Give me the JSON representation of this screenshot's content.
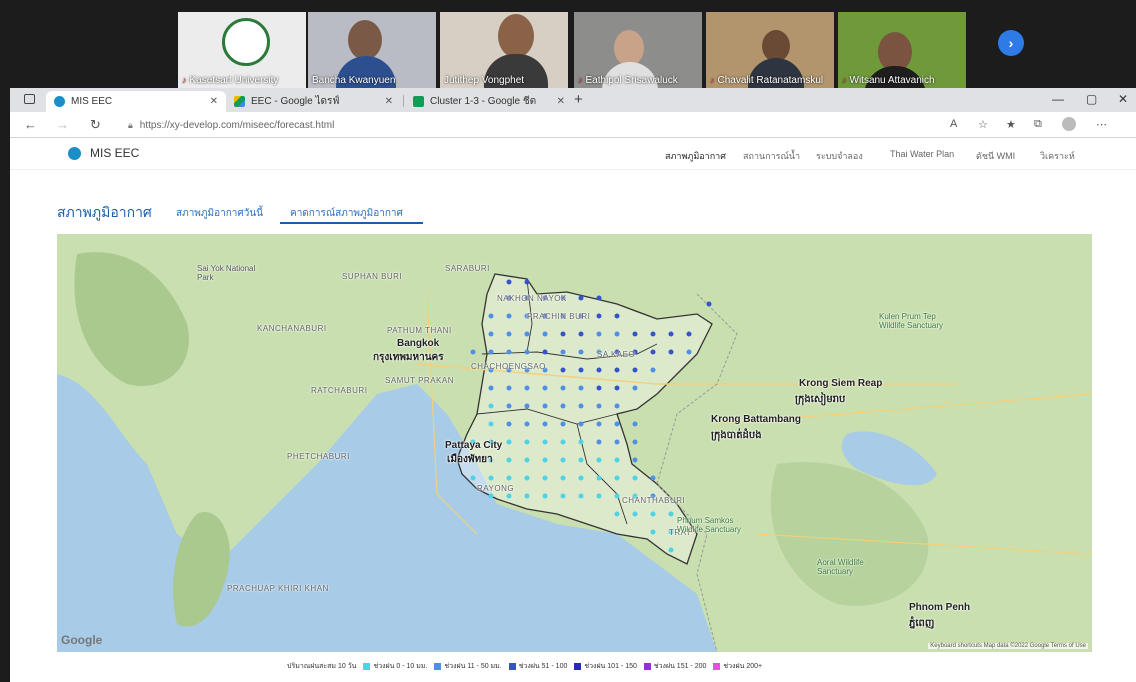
{
  "video_call": {
    "participants": [
      {
        "name": "Kasetsart University"
      },
      {
        "name": "Bancha Kwanyuen"
      },
      {
        "name": "Jutithep Vongphet"
      },
      {
        "name": "Eathipol Srisawaluck"
      },
      {
        "name": "Chavalit Ratanatamskul"
      },
      {
        "name": "Witsanu Attavanich"
      }
    ],
    "next_icon": "chevron-right-icon"
  },
  "browser": {
    "tabs": [
      {
        "label": "MIS EEC",
        "color": "#1a8fc7"
      },
      {
        "label": "EEC - Google ไดรฟ์",
        "color": "#f4b400"
      },
      {
        "label": "Cluster 1-3 - Google ชีต",
        "color": "#0f9d58"
      }
    ],
    "url": "https://xy-develop.com/miseec/forecast.html"
  },
  "app": {
    "title": "MIS EEC",
    "menu": [
      {
        "label": "สภาพภูมิอากาศ"
      },
      {
        "label": "สถานการณ์น้ำ"
      },
      {
        "label": "ระบบจำลอง"
      },
      {
        "label": "Thai Water Plan"
      },
      {
        "label": "ดัชนี WMI"
      },
      {
        "label": "วิเคราะห์"
      }
    ]
  },
  "page": {
    "title": "สภาพภูมิอากาศ",
    "subtabs": [
      {
        "label": "สภาพภูมิอากาศวันนี้"
      },
      {
        "label": "คาดการณ์สภาพภูมิอากาศ"
      }
    ]
  },
  "map": {
    "labels": {
      "suphan_buri": "SUPHAN BURI",
      "saraburi": "SARABURI",
      "kanchanaburi": "KANCHANABURI",
      "pathum_thani": "PATHUM THANI",
      "bangkok": "Bangkok",
      "bangkok_th": "กรุงเทพมหานคร",
      "samut_prakan": "SAMUT PRAKAN",
      "ratchaburi": "RATCHABURI",
      "phetchaburi": "PHETCHABURI",
      "chachoengsao": "CHACHOENGSAO",
      "prachin_buri": "PRACHIN BURI",
      "nakhon_nayok": "NAKHON NAYOK",
      "sa_kaeo": "SA KAEO",
      "pattaya": "Pattaya City",
      "pattaya_th": "เมืองพัทยา",
      "rayong": "RAYONG",
      "chanthaburi": "CHANTHABURI",
      "trat": "TRAT",
      "prachuap": "PRACHUAP KHIRI KHAN",
      "siem_reap": "Krong Siem Reap",
      "siem_reap_km": "ក្រុងសៀមរាប",
      "battambang": "Krong Battambang",
      "battambang_km": "ក្រុងបាត់ដំបង",
      "phnom_penh": "Phnom Penh",
      "phnom_penh_km": "ភ្នំពេញ",
      "sai_yok": "Sai Yok National Park",
      "phnum_samkos": "Phnum Samkos Wildlife Sanctuary",
      "aoral": "Aoral Wildlife Sanctuary",
      "kulen": "Kulen Prum Tep Wildlife Sanctuary"
    },
    "google": "Google",
    "footer": "Keyboard shortcuts   Map data ©2022 Google   Terms of Use"
  },
  "legend": {
    "prefix": "ปริมาณฝนสะสม 10 วัน",
    "items": [
      {
        "label": "ช่วงฝน 0 - 10 มม.",
        "color": "#4fd2e6"
      },
      {
        "label": "ช่วงฝน 11 - 50 มม.",
        "color": "#4f8fe6"
      },
      {
        "label": "ช่วงฝน 51 - 100",
        "color": "#3554c9"
      },
      {
        "label": "ช่วงฝน 101 - 150",
        "color": "#2a2ab0"
      },
      {
        "label": "ช่วงฝน 151 - 200",
        "color": "#9a2fd0"
      },
      {
        "label": "ช่วงฝน 200+",
        "color": "#e64fd6"
      }
    ]
  }
}
